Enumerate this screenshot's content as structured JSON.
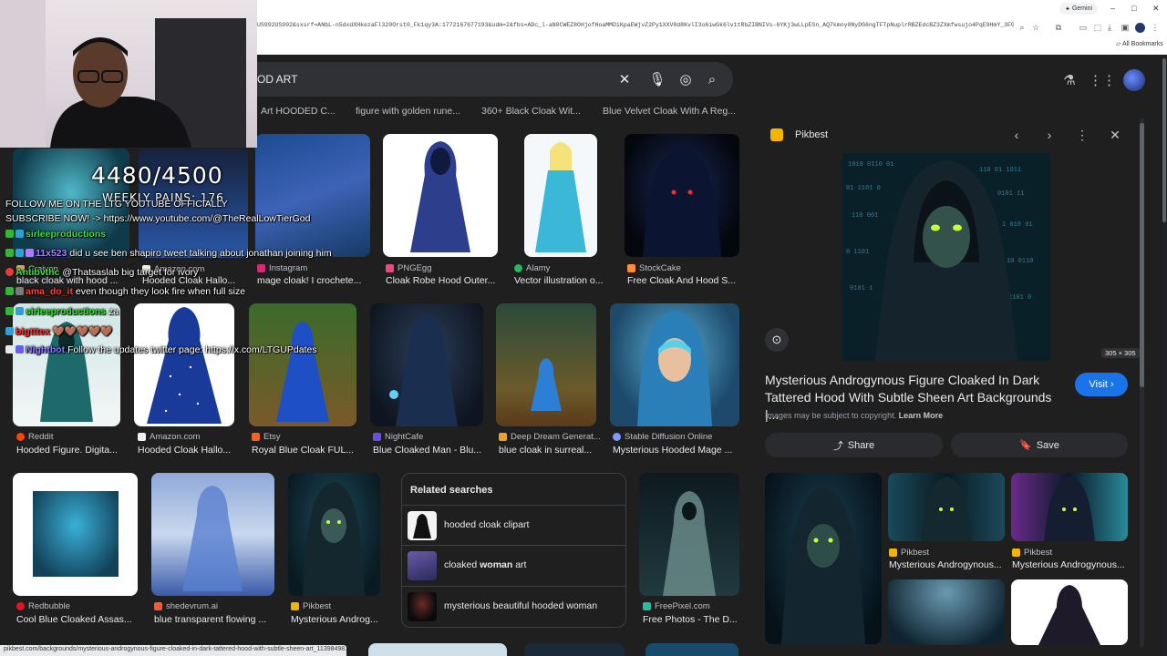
{
  "browser": {
    "url": "US992US992&sxsrf=ANbL-n5dxdXHkezaFl320Orst0_Fk1qy3A:1772167677193&udm=2&fbs=ADc_l-aN0CWEZ8OHjofHoaMMDiKpaEWjvZ2Py1XXV8d8KvlI3o6iwGk6lv1tRbZIBNIVs-6YKj3wLLpESn_AQ7kmny0NyDG6ngTFTpNuplrRBZEdcBZ3ZXmfwsujo4PqE9HmY_3FGX8...",
    "gemini_label": "Gemini",
    "all_bookmarks": "All Bookmarks"
  },
  "search": {
    "query": "OD ART"
  },
  "top_captions": [
    "Art HOODED C...",
    "figure with golden rune...",
    "360+ Black Cloak Wit...",
    "Blue Velvet Cloak With A Reg..."
  ],
  "row1": [
    {
      "source": "Instagram",
      "title": "mage cloak! I crochete..."
    },
    {
      "source": "PNGEgg",
      "title": "Cloak Robe Hood Outer..."
    },
    {
      "source": "Alamy",
      "title": "Vector illustration o..."
    },
    {
      "source": "StockCake",
      "title": "Free Cloak And Hood S..."
    }
  ],
  "row1_left": [
    {
      "source": "Craiyon",
      "title": "black cloak with hood ..."
    },
    {
      "source": "Amazon.com",
      "title": "Hooded Cloak Hallo..."
    }
  ],
  "row2": [
    {
      "source": "Reddit",
      "title": "Hooded Figure. Digita..."
    },
    {
      "source": "Amazon.com",
      "title": "Hooded Cloak Hallo..."
    },
    {
      "source": "Etsy",
      "title": "Royal Blue Cloak FUL..."
    },
    {
      "source": "NightCafe",
      "title": "Blue Cloaked Man - Blu..."
    },
    {
      "source": "Deep Dream Generat...",
      "title": "blue cloak in surreal..."
    },
    {
      "source": "Stable Diffusion Online",
      "title": "Mysterious Hooded Mage ..."
    }
  ],
  "row3": [
    {
      "source": "Redbubble",
      "title": "Cool Blue Cloaked Assas..."
    },
    {
      "source": "shedevrum.ai",
      "title": "blue transparent flowing ..."
    },
    {
      "source": "Pikbest",
      "title": "Mysterious Androg..."
    },
    {
      "source": "FreePixel.com",
      "title": "Free Photos - The D..."
    }
  ],
  "related": {
    "title": "Related searches",
    "items": [
      {
        "pre": "hooded cloak clipart",
        "bold": "",
        "post": ""
      },
      {
        "pre": "cloaked ",
        "bold": "woman",
        "post": " art"
      },
      {
        "pre": "mysterious beautiful hooded woman",
        "bold": "",
        "post": ""
      }
    ]
  },
  "panel": {
    "site": "Pikbest",
    "dims": "305 × 305",
    "title": "Mysterious Androgynous Figure Cloaked In Dark Tattered Hood With Subtle Sheen Art Backgrounds |...",
    "visit": "Visit",
    "copyright": "Images may be subject to copyright.",
    "learn_more": "Learn More",
    "share": "Share",
    "save": "Save",
    "similar": [
      {
        "source": "Pikbest",
        "title": "Mysterious Androgynous..."
      },
      {
        "source": "Pikbest",
        "title": "Mysterious Androgynous..."
      }
    ]
  },
  "status_url": "pikbest.com/backgrounds/mysterious-androgynous-figure-cloaked-in-dark-tattered-hood-with-subtle-sheen-art_11398498.html",
  "overlay": {
    "counter": "4480/4500",
    "weekly": "WEEKLY PAINS: 176",
    "chat": [
      {
        "user": "",
        "msg": "FOLLOW ME ON THE LTG YOUTUBE OFFICIALLY",
        "ucolor": "#ffffff"
      },
      {
        "user": "",
        "msg": "SUBSCRIBE NOW! -> https://www.youtube.com/@TheRealLowTierGod",
        "ucolor": "#ffffff"
      },
      {
        "user": "sirleeproductions",
        "msg": "",
        "ucolor": "#35e835"
      },
      {
        "user": "11x523",
        "msg": "did u see ben shapiro tweet talking about jonathan joining him",
        "ucolor": "#b07cff"
      },
      {
        "user": "Antibvthc",
        "msg": "@Thatsaslab big target for ivory",
        "ucolor": "#35e835"
      },
      {
        "user": "ama_do_it",
        "msg": "even though they look fire when full size",
        "ucolor": "#ff4040"
      },
      {
        "user": "sirleeproductions",
        "msg": "za",
        "ucolor": "#35e835"
      },
      {
        "user": "bigtttex",
        "msg": "",
        "ucolor": "#ff3030"
      },
      {
        "user": "Nightbot",
        "msg": "Follow the updates twitter page: https://x.com/LTGUPdates",
        "ucolor": "#8a7cff"
      }
    ]
  },
  "colors": {
    "accent": "#1a73e8",
    "pikbest": "#f5b400",
    "bg": "#1f1f1f"
  }
}
